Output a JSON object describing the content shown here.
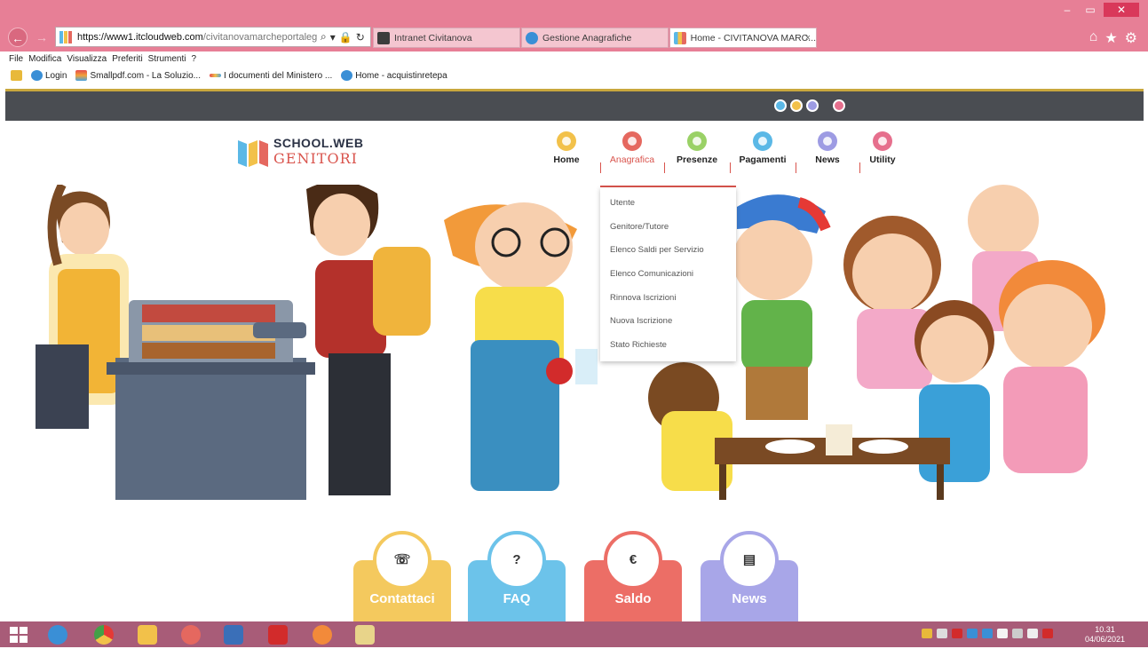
{
  "browser": {
    "url_host": "https://www1.itcloudweb.com",
    "url_path": "/civitanovamarcheportalegen",
    "tabs": [
      {
        "label": "Intranet Civitanova",
        "icon": "intranet-icon"
      },
      {
        "label": "Gestione Anagrafiche",
        "icon": "ie-icon"
      },
      {
        "label": "Home - CIVITANOVA MARC...",
        "icon": "schoolweb-icon",
        "active": true
      }
    ],
    "menu": [
      "File",
      "Modifica",
      "Visualizza",
      "Preferiti",
      "Strumenti",
      "?"
    ],
    "favorites": [
      {
        "label": "Login",
        "icon": "ie-icon"
      },
      {
        "label": "Smallpdf.com - La Soluzio...",
        "icon": "smallpdf-icon"
      },
      {
        "label": "I documenti del Ministero ...",
        "icon": "ministero-icon"
      },
      {
        "label": "Home - acquistinretepa",
        "icon": "ie-icon"
      }
    ]
  },
  "site": {
    "logo_line1": "SCHOOL.WEB",
    "logo_line2": "GENITORI",
    "nav": [
      {
        "label": "Home",
        "color": "#f2c14a",
        "icon": "home-icon"
      },
      {
        "label": "Anagrafica",
        "color": "#e5685f",
        "icon": "user-icon",
        "active": true
      },
      {
        "label": "Presenze",
        "color": "#9ad166",
        "icon": "calendar-icon"
      },
      {
        "label": "Pagamenti",
        "color": "#5bb8e6",
        "icon": "payment-icon"
      },
      {
        "label": "News",
        "color": "#9d9be3",
        "icon": "news-icon"
      },
      {
        "label": "Utility",
        "color": "#e66f8d",
        "icon": "link-icon"
      }
    ],
    "dropdown": [
      "Utente",
      "Genitore/Tutore",
      "Elenco Saldi per Servizio",
      "Elenco Comunicazioni",
      "Rinnova Iscrizioni",
      "Nuova Iscrizione",
      "Stato Richieste"
    ],
    "bottom_buttons": [
      {
        "label": "Contattaci",
        "symbol": "☏",
        "color": "#f4c95e",
        "icon": "phone-icon"
      },
      {
        "label": "FAQ",
        "symbol": "?",
        "color": "#6cc3ea",
        "icon": "question-icon"
      },
      {
        "label": "Saldo",
        "symbol": "€",
        "color": "#ec6e66",
        "icon": "euro-icon"
      },
      {
        "label": "News",
        "symbol": "▤",
        "color": "#a8a6e8",
        "icon": "newspaper-icon"
      }
    ]
  },
  "taskbar": {
    "time": "10.31",
    "date": "04/06/2021"
  }
}
